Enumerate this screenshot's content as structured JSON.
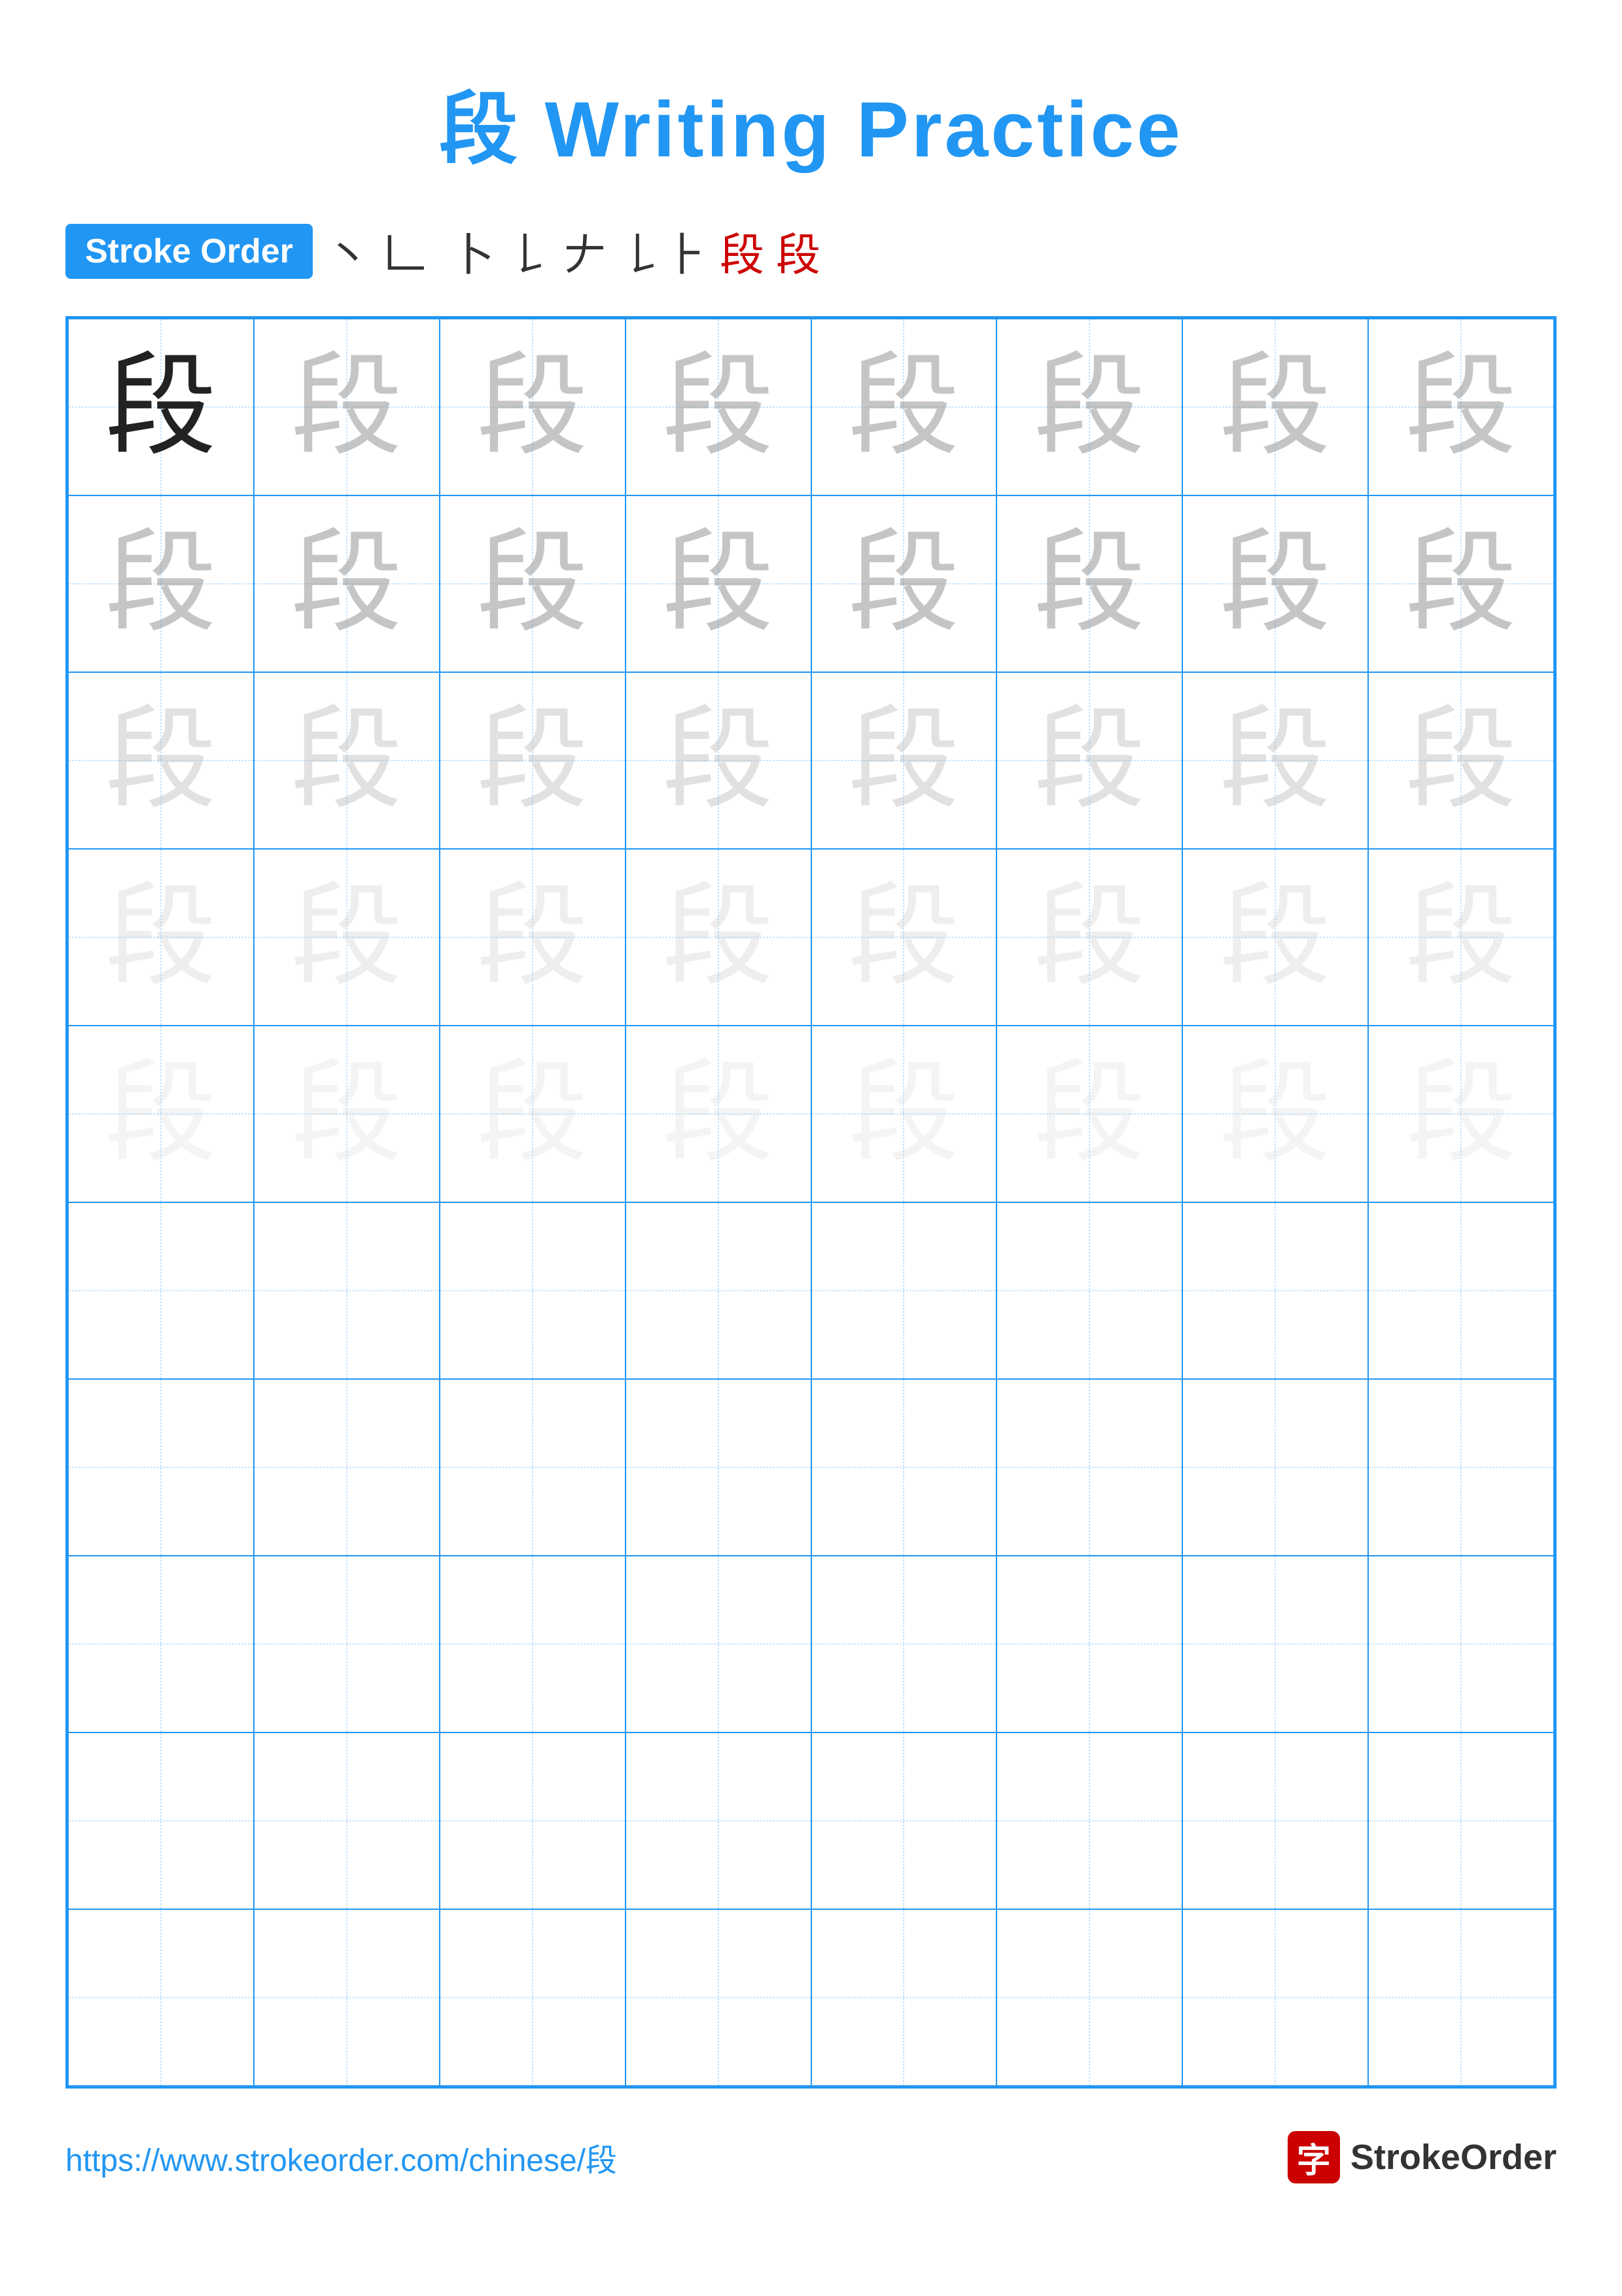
{
  "title": "段 Writing Practice",
  "stroke_order": {
    "badge_label": "Stroke Order",
    "strokes": [
      "丶",
      "𠃊",
      "𠃉",
      "⺊",
      "𠄌",
      "𠂇",
      "𠄌⺊",
      "段",
      "段"
    ]
  },
  "character": "段",
  "grid": {
    "cols": 8,
    "practice_rows": 5,
    "empty_rows": 5
  },
  "footer": {
    "url": "https://www.strokeorder.com/chinese/段",
    "logo_char": "字",
    "logo_name": "StrokeOrder"
  }
}
